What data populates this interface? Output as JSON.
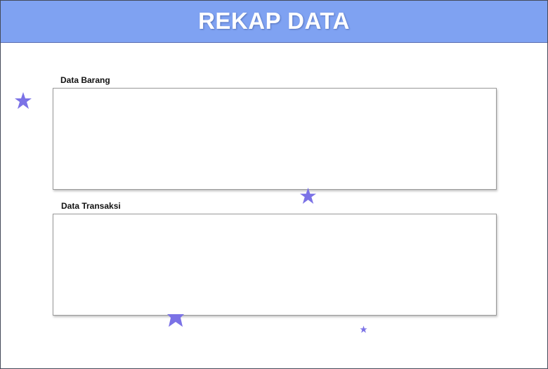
{
  "header": {
    "title": "REKAP DATA",
    "color": "#7fa2f2"
  },
  "sections": [
    {
      "label": "Data Barang"
    },
    {
      "label": "Data Transaksi"
    }
  ],
  "decorations": {
    "icon": "star-icon",
    "color": "#7b72e6"
  }
}
